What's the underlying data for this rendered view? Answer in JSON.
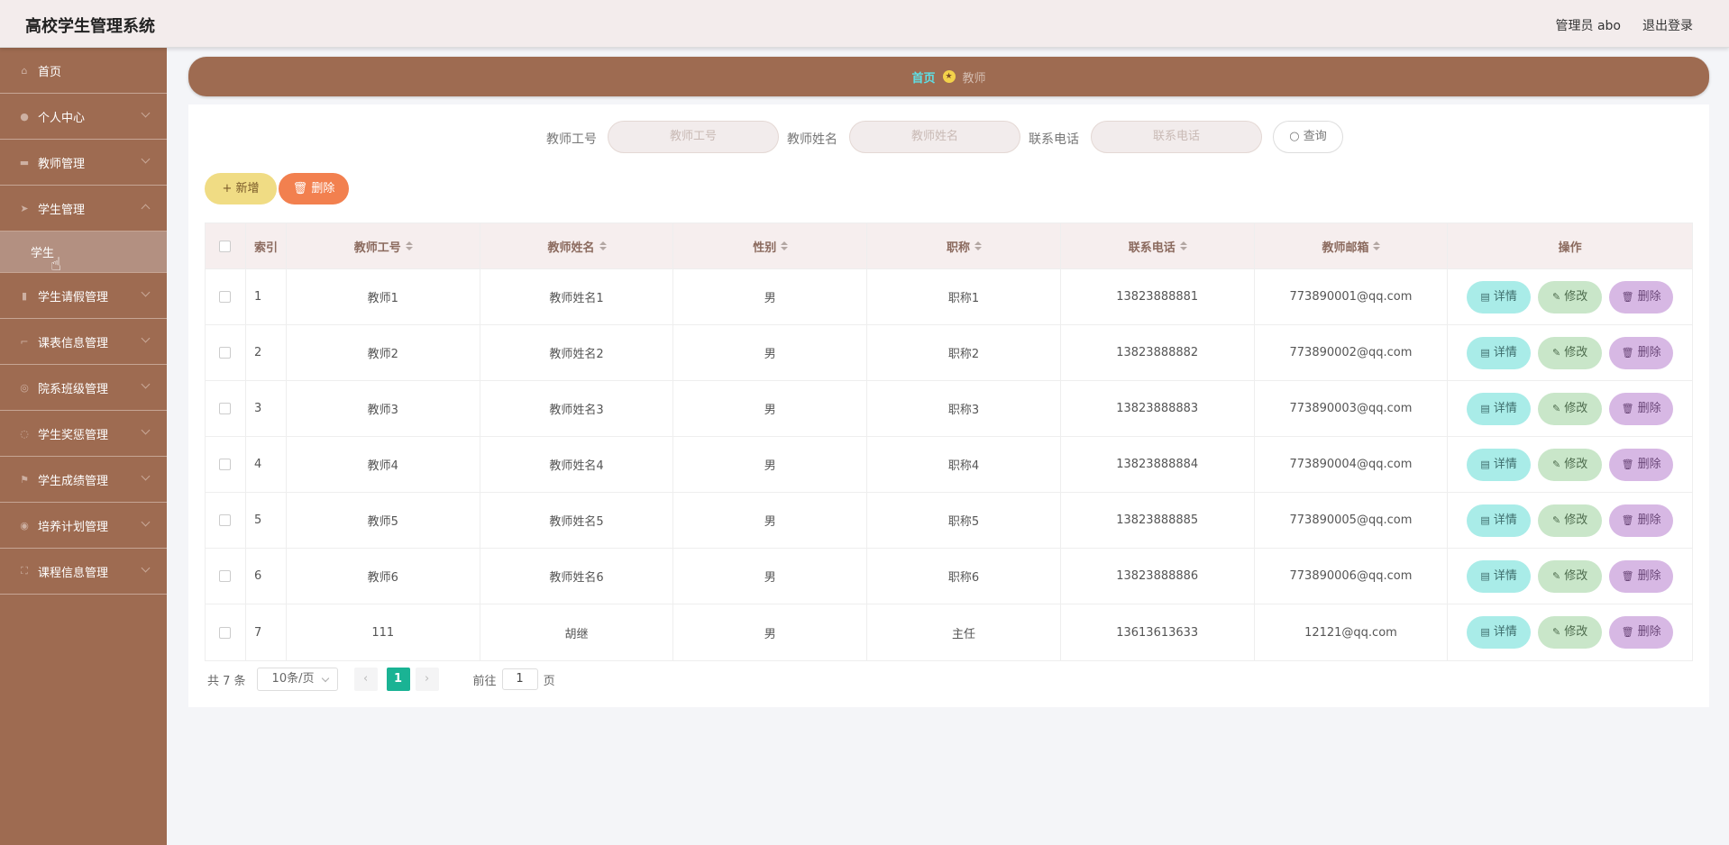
{
  "header": {
    "title": "高校学生管理系统",
    "admin": "管理员 abo",
    "logout": "退出登录"
  },
  "sidebar": {
    "items": [
      {
        "label": "首页",
        "icon": "home-icon",
        "chevron": false
      },
      {
        "label": "个人中心",
        "icon": "user-icon",
        "chevron": true
      },
      {
        "label": "教师管理",
        "icon": "briefcase-icon",
        "chevron": true
      },
      {
        "label": "学生管理",
        "icon": "send-icon",
        "chevron": true,
        "open": true,
        "sub": [
          "学生"
        ]
      },
      {
        "label": "学生请假管理",
        "icon": "chart-icon",
        "chevron": true
      },
      {
        "label": "课表信息管理",
        "icon": "crop-icon",
        "chevron": true
      },
      {
        "label": "院系班级管理",
        "icon": "basketball-icon",
        "chevron": true
      },
      {
        "label": "学生奖惩管理",
        "icon": "loading-icon",
        "chevron": true
      },
      {
        "label": "学生成绩管理",
        "icon": "flag-icon",
        "chevron": true
      },
      {
        "label": "培养计划管理",
        "icon": "globe-icon",
        "chevron": true
      },
      {
        "label": "课程信息管理",
        "icon": "fullscreen-icon",
        "chevron": true
      }
    ]
  },
  "breadcrumb": {
    "home": "首页",
    "current": "教师"
  },
  "search": {
    "fields": [
      {
        "label": "教师工号",
        "placeholder": "教师工号"
      },
      {
        "label": "教师姓名",
        "placeholder": "教师姓名"
      },
      {
        "label": "联系电话",
        "placeholder": "联系电话"
      }
    ],
    "button": "查询"
  },
  "actions": {
    "add": "新增",
    "delete": "删除"
  },
  "table": {
    "headers": [
      "索引",
      "教师工号",
      "教师姓名",
      "性别",
      "职称",
      "联系电话",
      "教师邮箱",
      "操作"
    ],
    "rows": [
      [
        "1",
        "教师1",
        "教师姓名1",
        "男",
        "职称1",
        "13823888881",
        "773890001@qq.com"
      ],
      [
        "2",
        "教师2",
        "教师姓名2",
        "男",
        "职称2",
        "13823888882",
        "773890002@qq.com"
      ],
      [
        "3",
        "教师3",
        "教师姓名3",
        "男",
        "职称3",
        "13823888883",
        "773890003@qq.com"
      ],
      [
        "4",
        "教师4",
        "教师姓名4",
        "男",
        "职称4",
        "13823888884",
        "773890004@qq.com"
      ],
      [
        "5",
        "教师5",
        "教师姓名5",
        "男",
        "职称5",
        "13823888885",
        "773890005@qq.com"
      ],
      [
        "6",
        "教师6",
        "教师姓名6",
        "男",
        "职称6",
        "13823888886",
        "773890006@qq.com"
      ],
      [
        "7",
        "111",
        "胡继",
        "男",
        "主任",
        "13613613633",
        "12121@qq.com"
      ]
    ],
    "ops": {
      "detail": "详情",
      "edit": "修改",
      "remove": "删除"
    }
  },
  "pagination": {
    "total": "共 7 条",
    "page_size": "10条/页",
    "current": "1",
    "goto_label": "前往",
    "goto_value": "1",
    "page_unit": "页"
  },
  "colors": {
    "brand": "#9e6b51",
    "active_page": "#1ab394",
    "crumb_home": "#5ee0e6"
  }
}
